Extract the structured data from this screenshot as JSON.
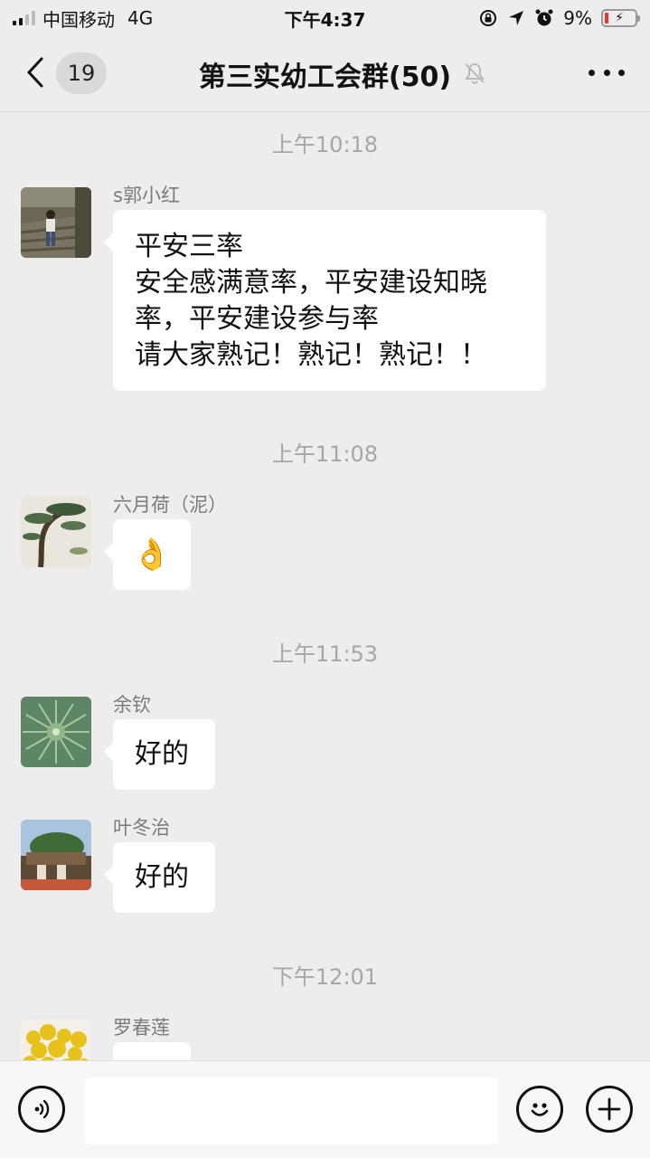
{
  "status_bar": {
    "carrier": "中国移动",
    "network": "4G",
    "time": "下午4:37",
    "battery": "9%"
  },
  "nav": {
    "unread_count": "19",
    "title": "第三实幼工会群(50)"
  },
  "messages": [
    {
      "timestamp": "上午10:18",
      "sender": "s郭小红",
      "lines": [
        "平安三率",
        "安全感满意率，平安建设知晓",
        "率，平安建设参与率",
        "请大家熟记！熟记！熟记！！"
      ]
    },
    {
      "timestamp": "上午11:08",
      "sender": "六月荷（泥）",
      "emoji": "👌"
    },
    {
      "timestamp": "上午11:53",
      "sender": "余钦",
      "text": "好的"
    },
    {
      "sender": "叶冬治",
      "text": "好的"
    },
    {
      "timestamp": "下午12:01",
      "sender": "罗春莲"
    }
  ],
  "icons": {
    "back": "chevron-left-icon",
    "mute": "bell-off-icon",
    "more": "more-icon",
    "voice": "voice-icon",
    "emoji": "emoji-icon",
    "add": "plus-icon"
  },
  "colors": {
    "background": "#ededed",
    "bubble": "#ffffff",
    "timestamp": "#a6a6a6",
    "sender": "#7b7b7b"
  },
  "input": {
    "value": "",
    "placeholder": ""
  }
}
